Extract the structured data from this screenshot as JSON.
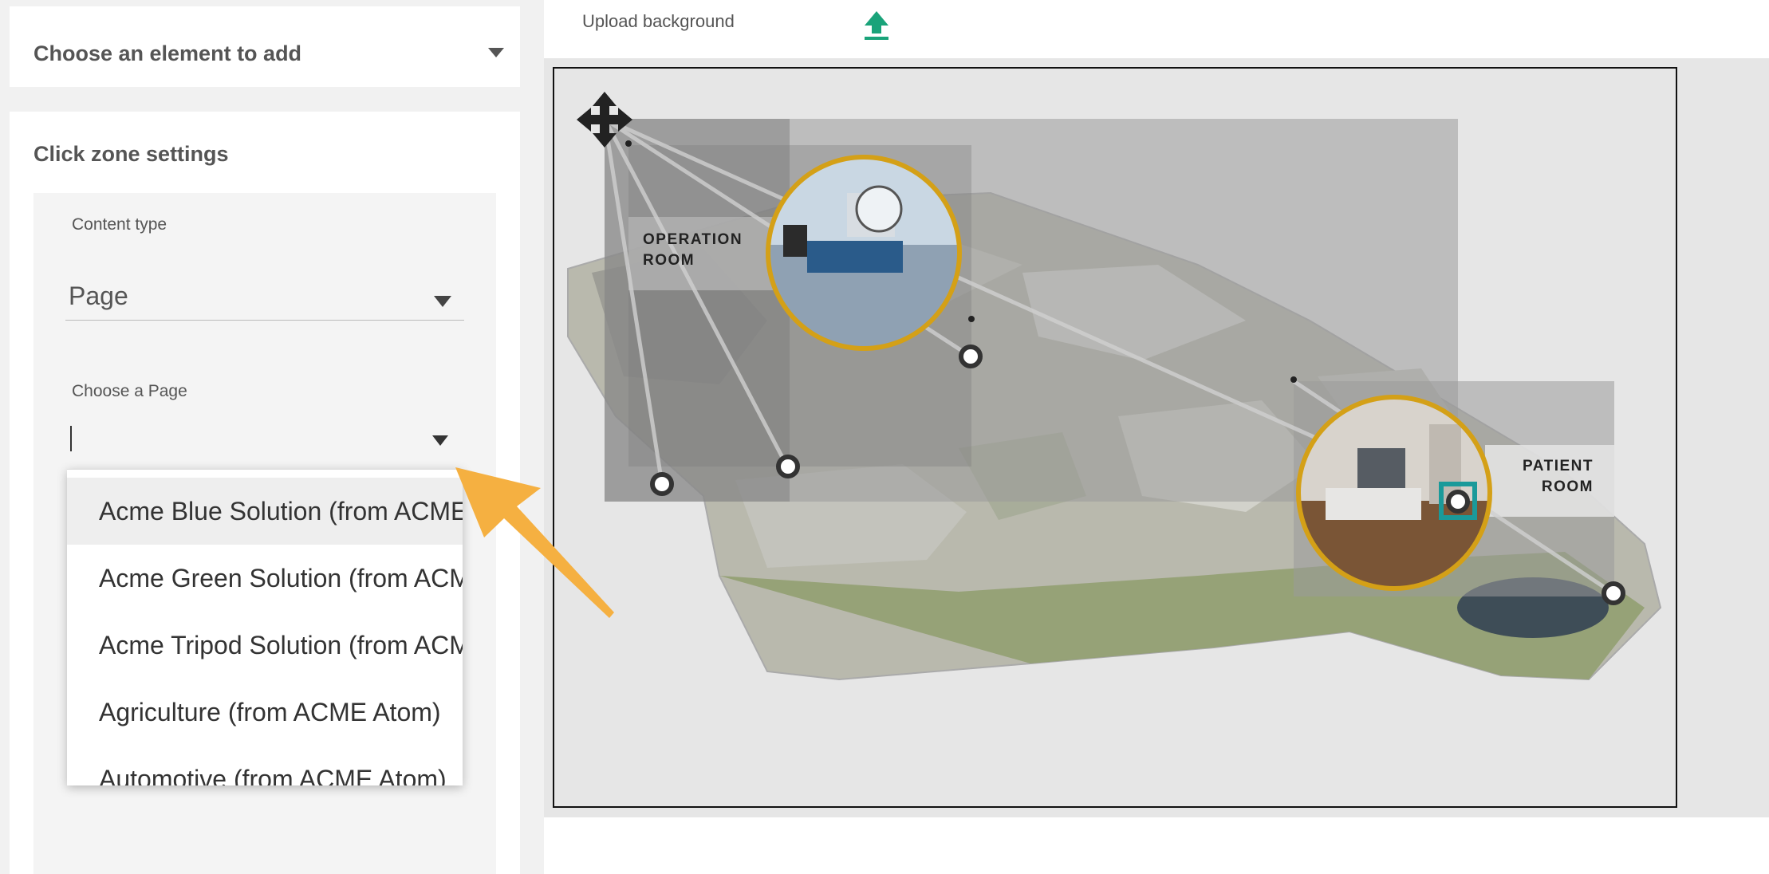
{
  "sidebar": {
    "add_element": {
      "label": "Choose an element to add"
    },
    "click_zone": {
      "title": "Click zone settings",
      "content_type": {
        "label": "Content type",
        "value": "Page"
      },
      "page": {
        "label": "Choose a Page",
        "value": "",
        "options": [
          "Acme Blue Solution (from ACME Atom)",
          "Acme Green Solution (from ACME Atom)",
          "Acme Tripod Solution (from ACME Atom)",
          "Agriculture (from ACME Atom)",
          "Automotive (from ACME Atom)"
        ],
        "highlighted_index": 0
      }
    }
  },
  "toolbar": {
    "upload_label": "Upload background"
  },
  "stage": {
    "zones": [
      {
        "label_line1": "OPERATION",
        "label_line2": "ROOM"
      },
      {
        "label_line1": "PATIENT",
        "label_line2": "ROOM"
      }
    ]
  },
  "colors": {
    "accent_teal": "#1aa37a",
    "ring_gold": "#d4a017",
    "selection_teal": "#1a9a9a",
    "annotation_arrow": "#f5b041"
  }
}
